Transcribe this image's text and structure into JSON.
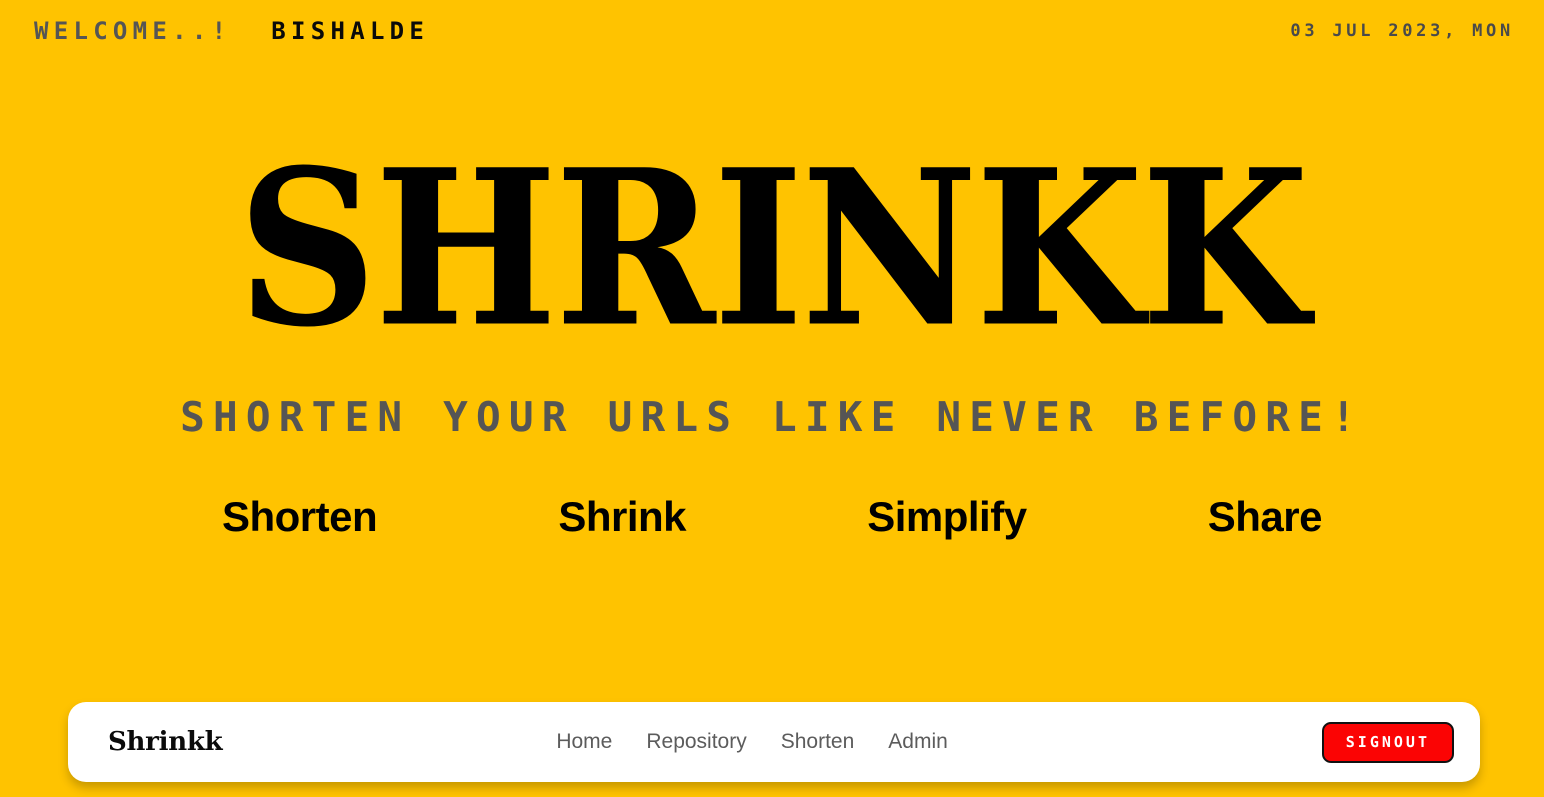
{
  "page": {
    "background_color": "#FFC300",
    "accent_color": "#FB0404"
  },
  "topbar": {
    "welcome_text": "WELCOME..!",
    "username": "BISHALDE",
    "date": "03 JUL 2023, MON"
  },
  "hero": {
    "brand_title": "SHRINKK",
    "tagline": "SHORTEN YOUR URLS LIKE NEVER BEFORE!",
    "features": [
      {
        "label": "Shorten"
      },
      {
        "label": "Shrink"
      },
      {
        "label": "Simplify"
      },
      {
        "label": "Share"
      }
    ]
  },
  "navbar": {
    "brand": "Shrinkk",
    "links": [
      {
        "label": "Home"
      },
      {
        "label": "Repository"
      },
      {
        "label": "Shorten"
      },
      {
        "label": "Admin"
      }
    ],
    "signout_label": "SIGNOUT"
  }
}
